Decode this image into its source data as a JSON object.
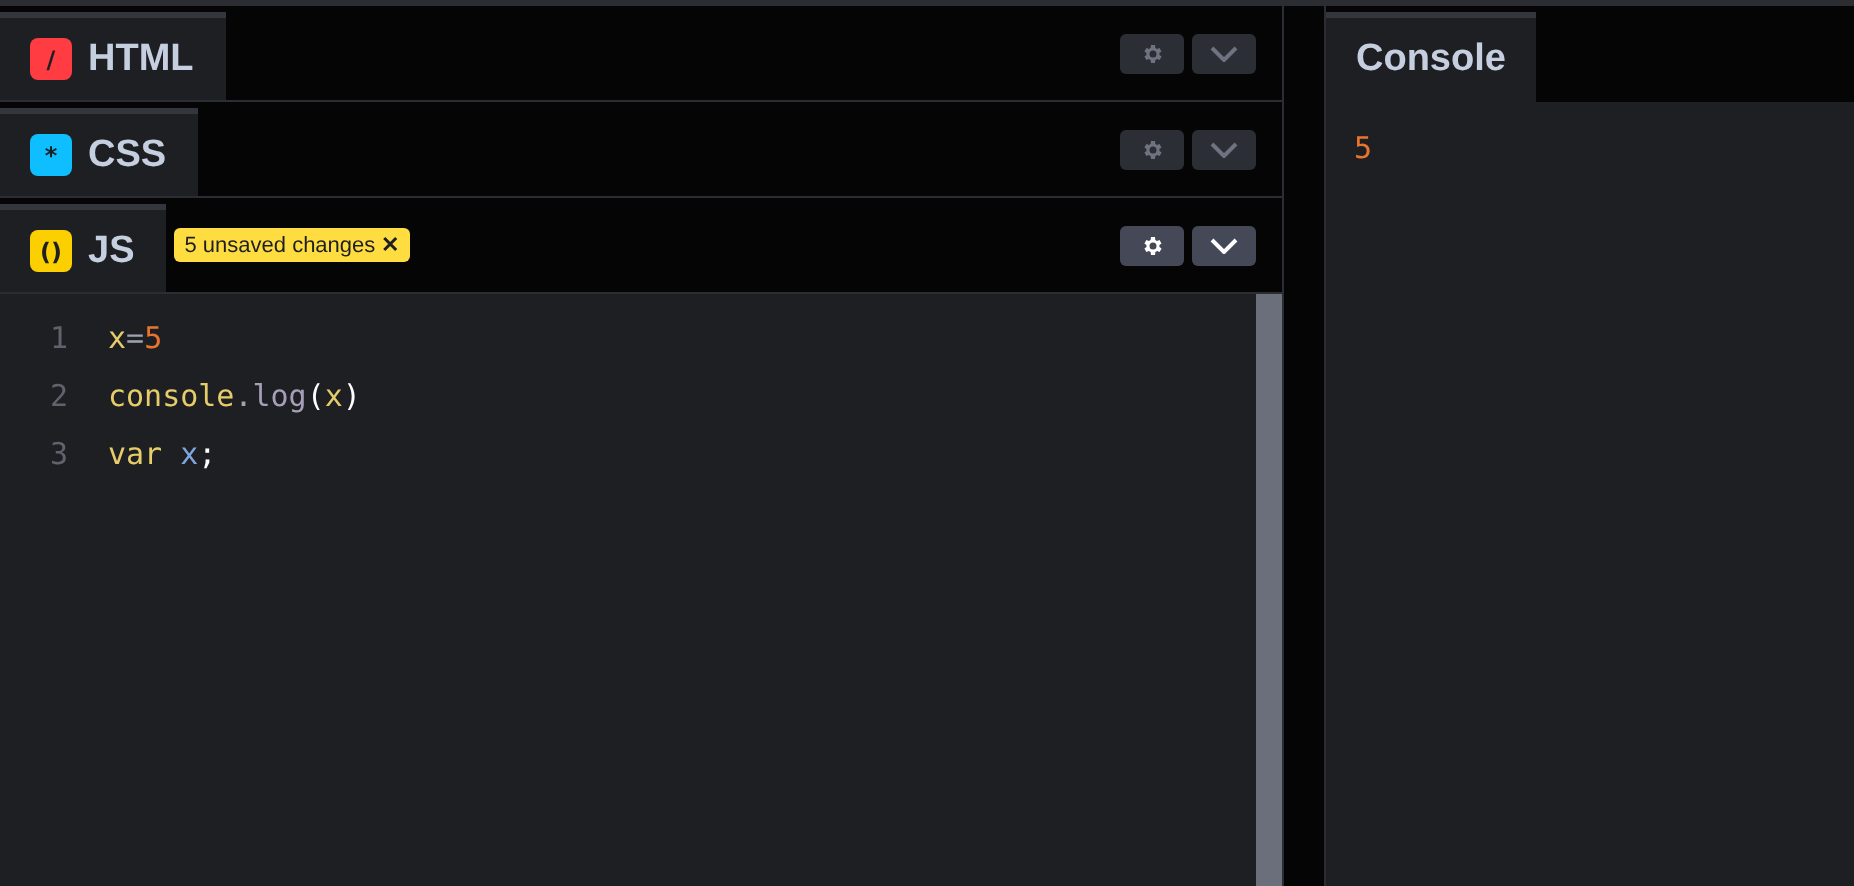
{
  "editors": [
    {
      "label": "HTML",
      "kind": "html",
      "icon": "/",
      "active": false
    },
    {
      "label": "CSS",
      "kind": "css",
      "icon": "*",
      "active": false
    },
    {
      "label": "JS",
      "kind": "js",
      "icon": "()",
      "active": true,
      "badge": "5 unsaved changes",
      "badge_close": "✕"
    }
  ],
  "code_lines": [
    {
      "number": "1",
      "tokens": [
        {
          "text": "x",
          "kind": "ident"
        },
        {
          "text": "=",
          "kind": "operator"
        },
        {
          "text": "5",
          "kind": "number"
        }
      ]
    },
    {
      "number": "2",
      "tokens": [
        {
          "text": "console",
          "kind": "ident"
        },
        {
          "text": ".",
          "kind": "punct"
        },
        {
          "text": "log",
          "kind": "method"
        },
        {
          "text": "(",
          "kind": "paren"
        },
        {
          "text": "x",
          "kind": "ident"
        },
        {
          "text": ")",
          "kind": "paren"
        }
      ]
    },
    {
      "number": "3",
      "tokens": [
        {
          "text": "var ",
          "kind": "keyword"
        },
        {
          "text": "x",
          "kind": "variable"
        },
        {
          "text": ";",
          "kind": "paren"
        }
      ]
    }
  ],
  "console": {
    "tab": "Console",
    "output": [
      "5"
    ]
  }
}
